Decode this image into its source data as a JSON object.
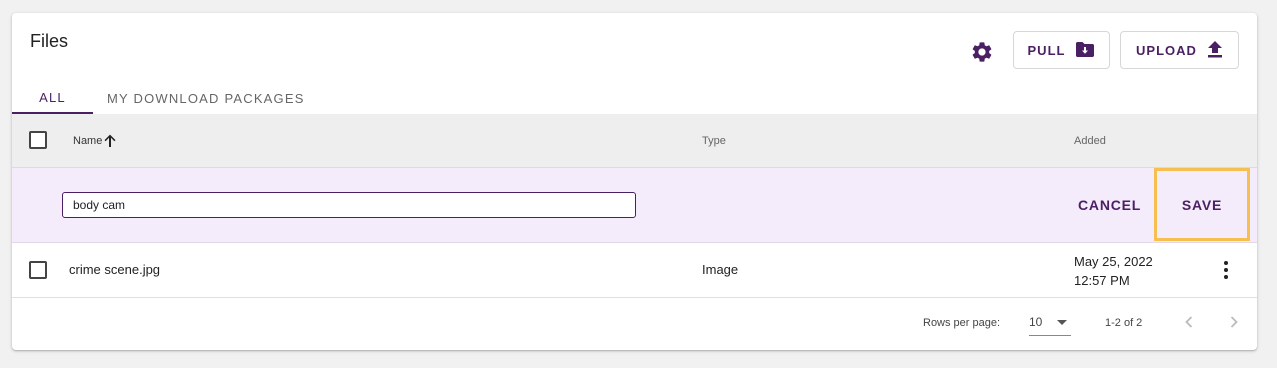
{
  "header": {
    "title": "Files",
    "settings_icon": "gear-icon",
    "pull_label": "PULL",
    "pull_icon": "folder-download-icon",
    "upload_label": "UPLOAD",
    "upload_icon": "upload-icon"
  },
  "tabs": [
    {
      "label": "ALL",
      "active": true
    },
    {
      "label": "MY DOWNLOAD PACKAGES",
      "active": false
    }
  ],
  "table": {
    "columns": {
      "name": "Name",
      "name_sort_icon": "arrow-up-icon",
      "type": "Type",
      "added": "Added"
    },
    "edit_row": {
      "input_value": "body cam",
      "cancel_label": "CANCEL",
      "save_label": "SAVE"
    },
    "rows": [
      {
        "name": "crime scene.jpg",
        "type": "Image",
        "added_date": "May 25, 2022",
        "added_time": "12:57 PM"
      }
    ]
  },
  "pagination": {
    "rows_per_page_label": "Rows per page:",
    "rows_per_page_value": "10",
    "range": "1-2 of 2"
  },
  "colors": {
    "accent": "#4a1f63",
    "edit_row_bg": "#f4ebfb",
    "highlight": "#f6bf4f"
  }
}
